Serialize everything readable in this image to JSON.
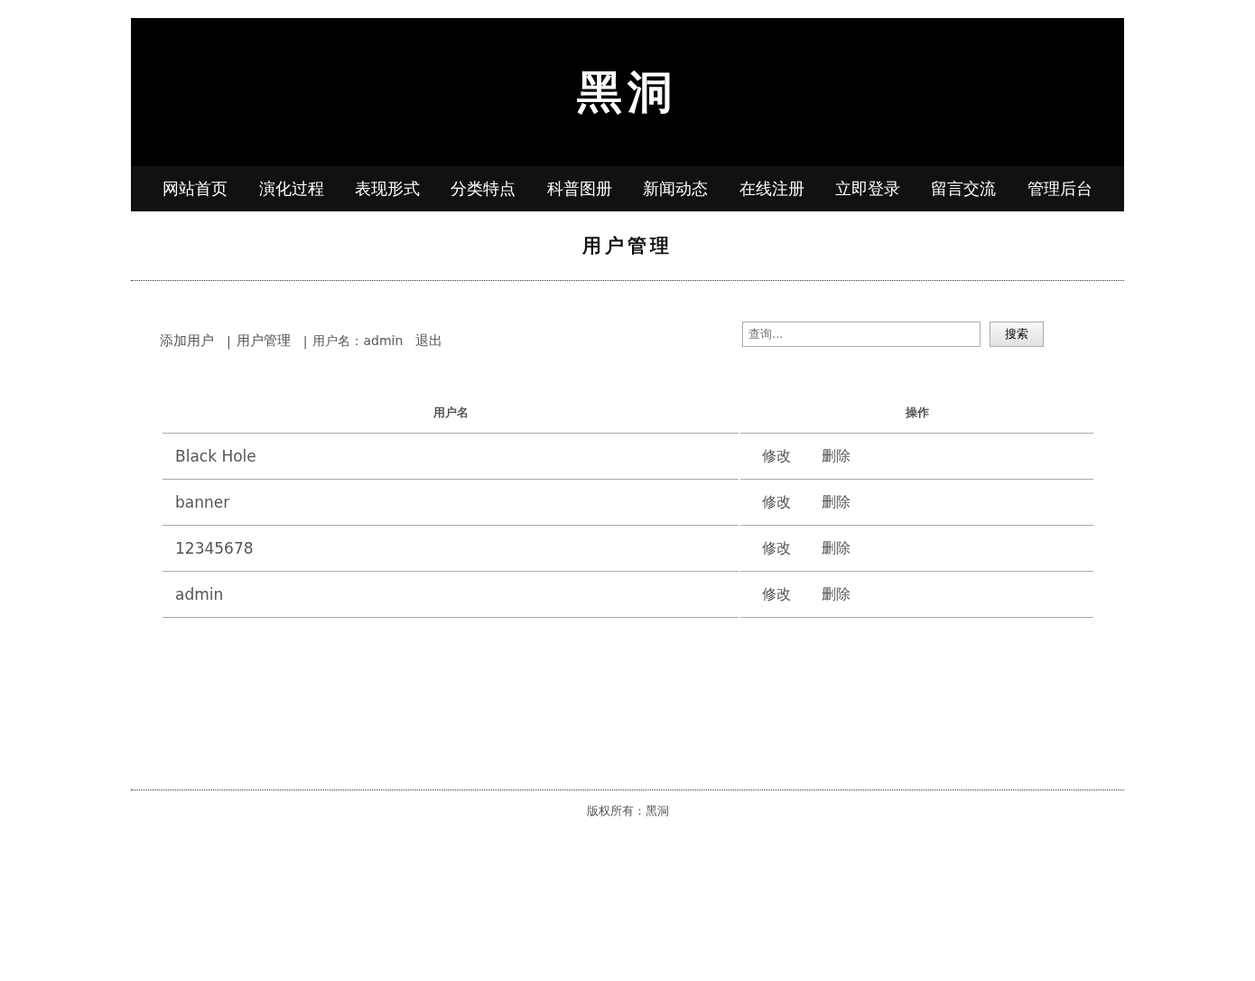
{
  "site_title": "黑洞",
  "nav": [
    {
      "label": "网站首页"
    },
    {
      "label": "演化过程"
    },
    {
      "label": "表现形式"
    },
    {
      "label": "分类特点"
    },
    {
      "label": "科普图册"
    },
    {
      "label": "新闻动态"
    },
    {
      "label": "在线注册"
    },
    {
      "label": "立即登录"
    },
    {
      "label": "留言交流"
    },
    {
      "label": "管理后台"
    }
  ],
  "page_heading": "用户管理",
  "toolbar": [
    {
      "kind": "link",
      "text": "添加用户"
    },
    {
      "kind": "separator",
      "text": "|"
    },
    {
      "kind": "link",
      "text": "用户管理"
    },
    {
      "kind": "separator",
      "text": "|"
    },
    {
      "kind": "info",
      "text": "用户名：admin"
    },
    {
      "kind": "link",
      "text": "退出"
    }
  ],
  "search": {
    "placeholder": "查询...",
    "button": "搜索"
  },
  "table": {
    "columns": [
      "用户名",
      "操作"
    ],
    "rows": [
      {
        "username": "Black Hole",
        "actions": [
          "修改",
          "删除"
        ]
      },
      {
        "username": "banner",
        "actions": [
          "修改",
          "删除"
        ]
      },
      {
        "username": "12345678",
        "actions": [
          "修改",
          "删除"
        ]
      },
      {
        "username": "admin",
        "actions": [
          "修改",
          "删除"
        ]
      }
    ]
  },
  "footer": "版权所有：黑洞"
}
